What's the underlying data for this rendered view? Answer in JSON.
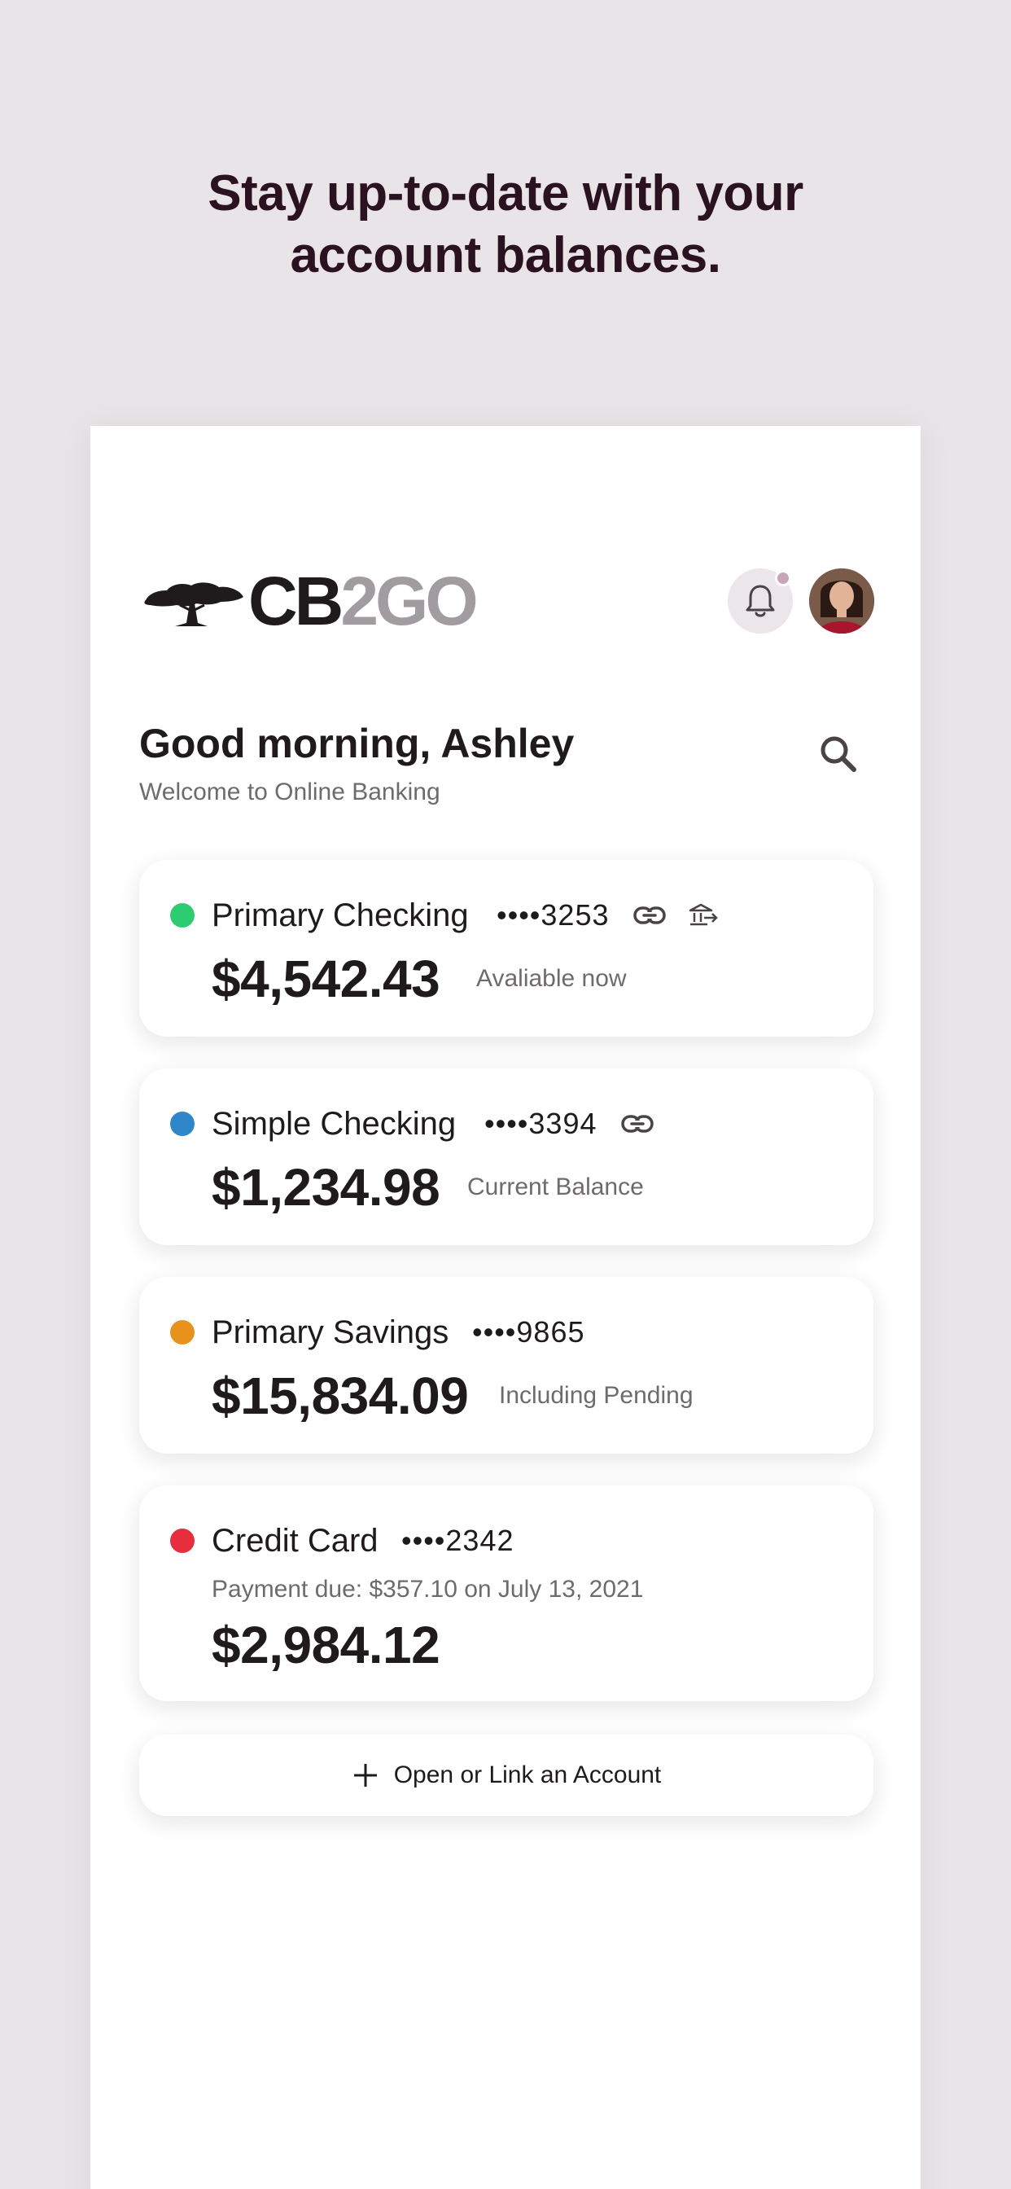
{
  "headline": {
    "line1": "Stay up-to-date with your",
    "line2": "account balances."
  },
  "header": {
    "logo_primary": "CB",
    "logo_secondary": "2GO",
    "bell_icon": "bell-icon",
    "notification_indicator": true
  },
  "greeting": {
    "title": "Good morning, Ashley",
    "subtitle": "Welcome to Online Banking"
  },
  "accounts": [
    {
      "name": "Primary Checking",
      "mask": "••••3253",
      "amount": "$4,542.43",
      "note": "Avaliable now",
      "dot_color": "#2ecc71",
      "icons": [
        "link-icon",
        "bank-transfer-icon"
      ]
    },
    {
      "name": "Simple Checking",
      "mask": "••••3394",
      "amount": "$1,234.98",
      "note": "Current Balance",
      "dot_color": "#2e86c8",
      "icons": [
        "link-icon"
      ]
    },
    {
      "name": "Primary Savings",
      "mask": "••••9865",
      "amount": "$15,834.09",
      "note": "Including Pending",
      "dot_color": "#e8921e",
      "icons": []
    },
    {
      "name": "Credit Card",
      "mask": "••••2342",
      "amount": "$2,984.12",
      "due": "Payment due: $357.10 on July 13, 2021",
      "dot_color": "#e62e3d",
      "icons": []
    }
  ],
  "actions": {
    "open_link_label": "Open or Link an Account"
  },
  "colors": {
    "background": "#e8e4e7",
    "headline": "#2b1220",
    "text": "#1f1b1d",
    "muted": "#6f6a6d",
    "logo_secondary": "#a19c9f"
  }
}
